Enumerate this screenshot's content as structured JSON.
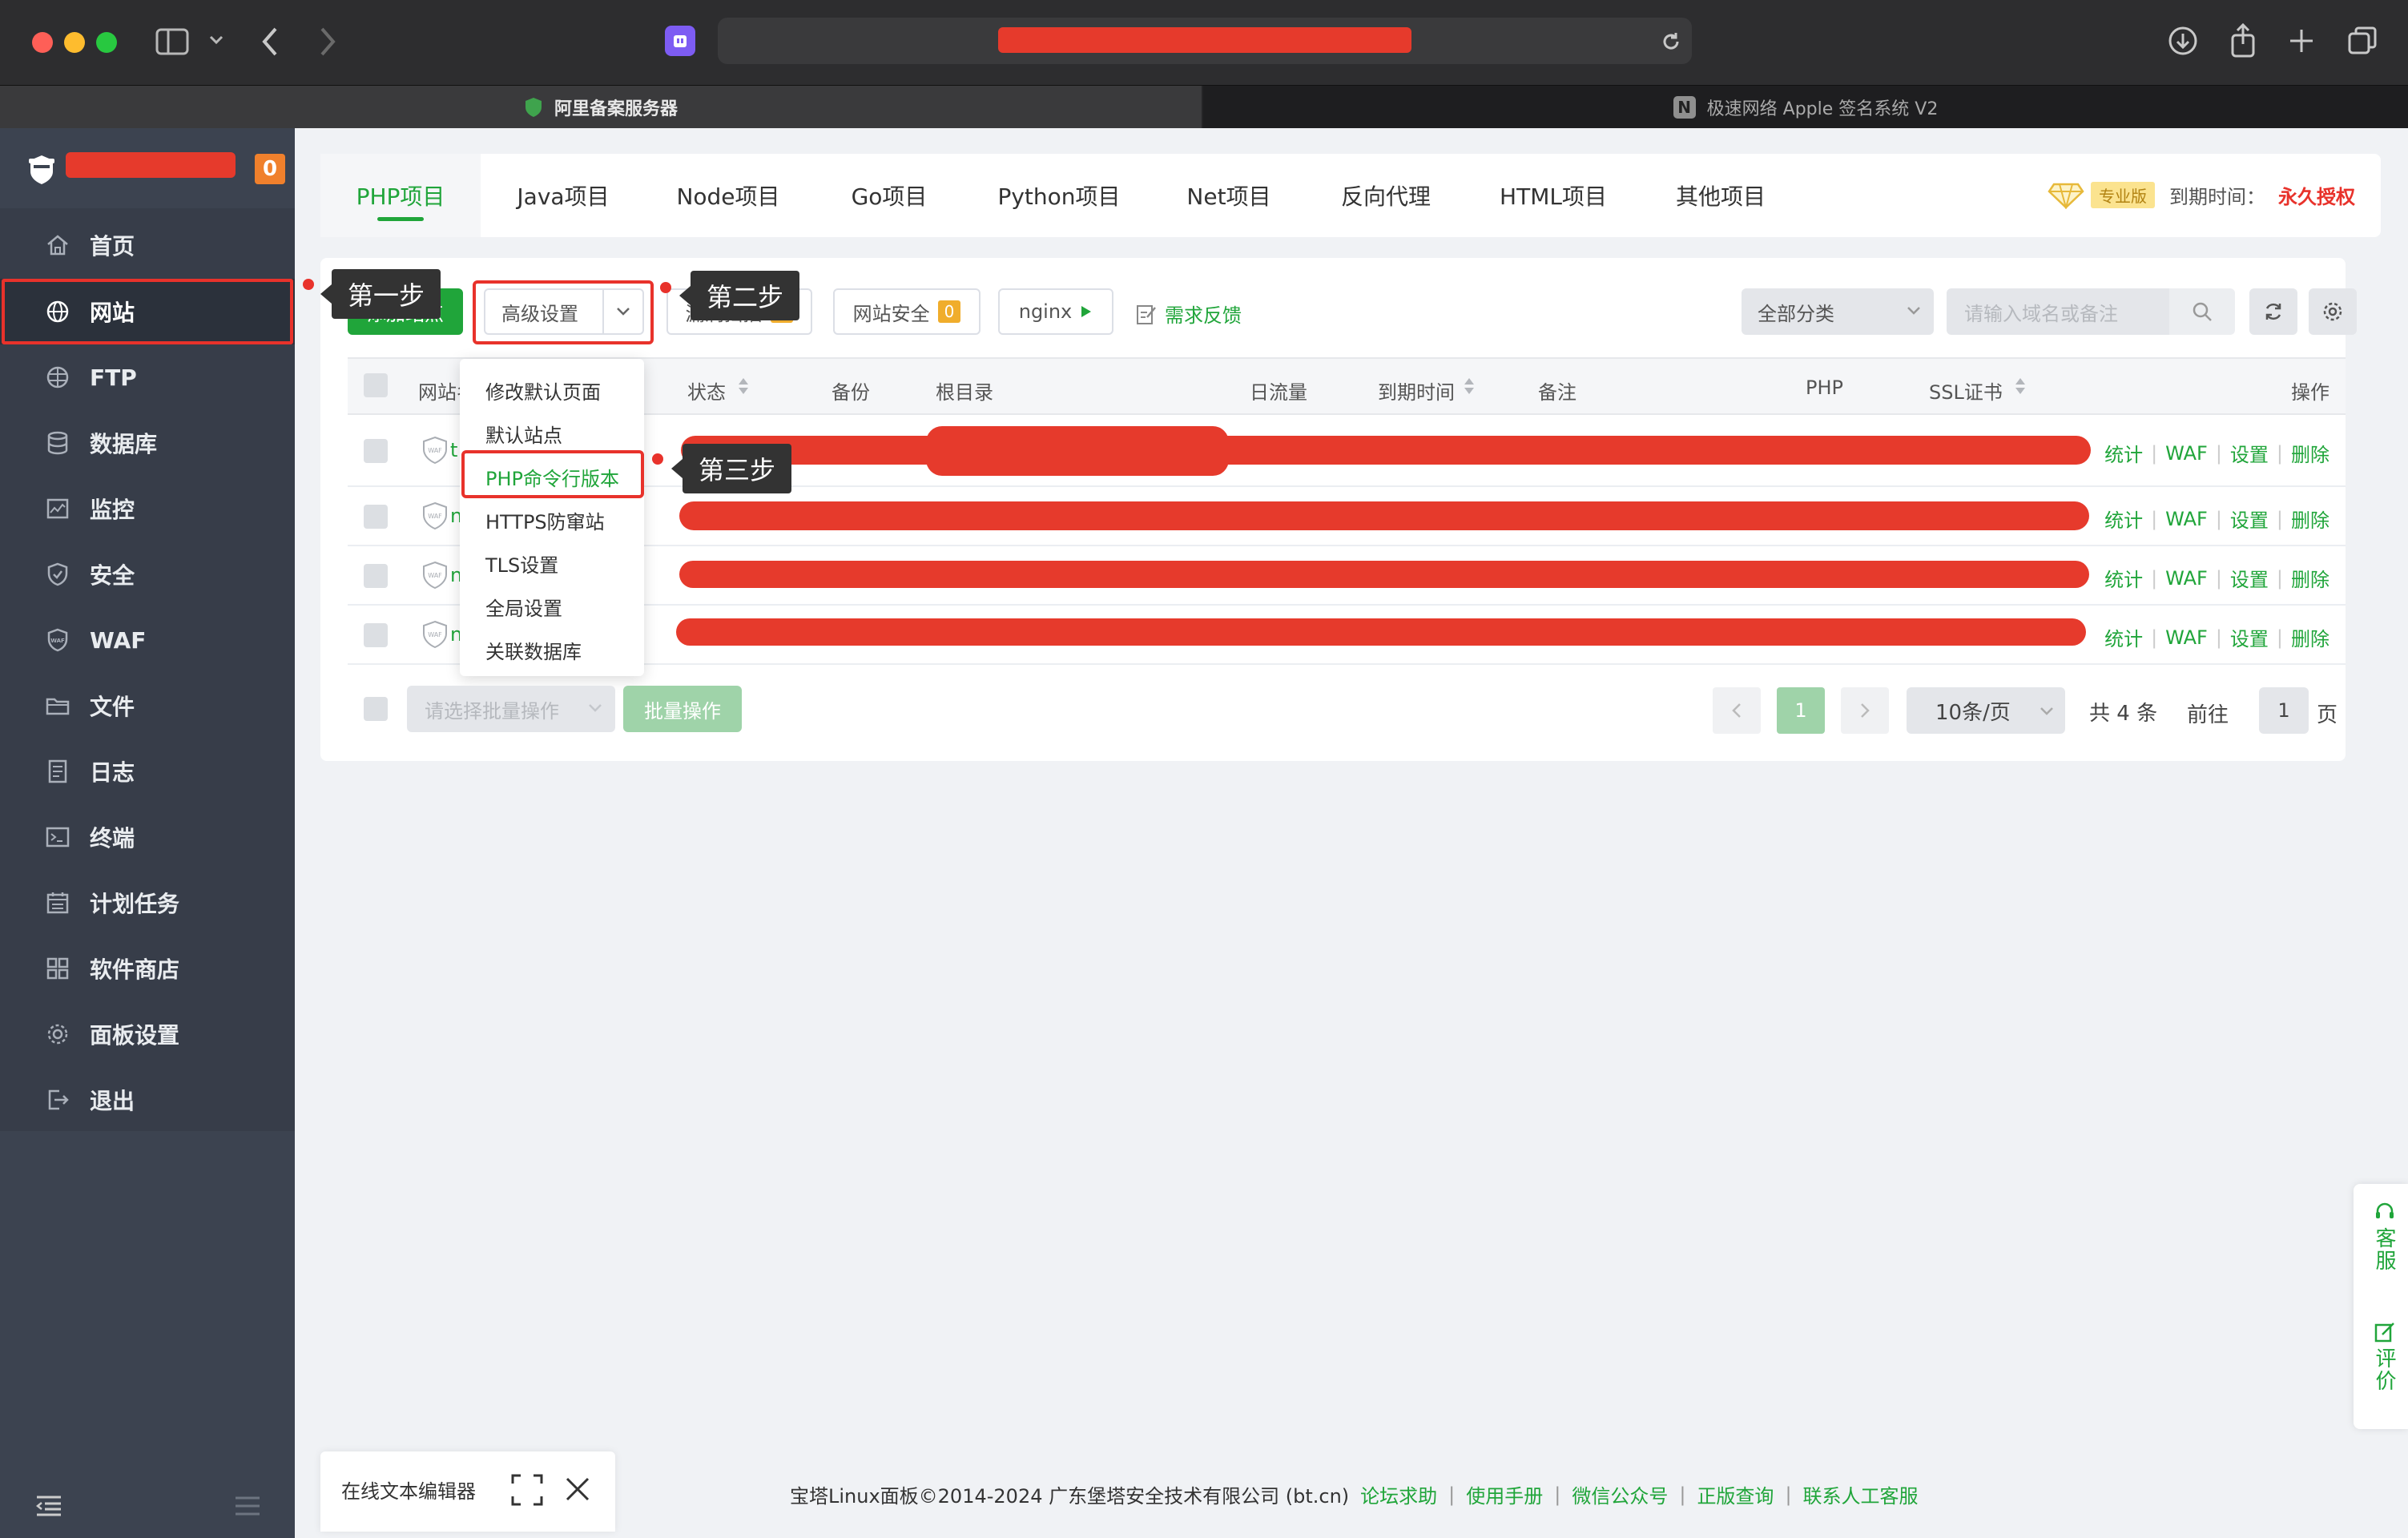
{
  "browser": {
    "tab_active": "阿里备案服务器",
    "tab_inactive": "极速网络 Apple 签名系统 V2",
    "tab_inactive_icon": "N"
  },
  "sidebar": {
    "badge_count": "0",
    "items": [
      {
        "label": "首页",
        "icon": "home-icon"
      },
      {
        "label": "网站",
        "icon": "globe-icon",
        "active": true
      },
      {
        "label": "FTP",
        "icon": "ftp-icon"
      },
      {
        "label": "数据库",
        "icon": "database-icon"
      },
      {
        "label": "监控",
        "icon": "monitor-icon"
      },
      {
        "label": "安全",
        "icon": "shield-icon"
      },
      {
        "label": "WAF",
        "icon": "waf-icon"
      },
      {
        "label": "文件",
        "icon": "folder-icon"
      },
      {
        "label": "日志",
        "icon": "log-icon"
      },
      {
        "label": "终端",
        "icon": "terminal-icon"
      },
      {
        "label": "计划任务",
        "icon": "calendar-icon"
      },
      {
        "label": "软件商店",
        "icon": "store-icon"
      },
      {
        "label": "面板设置",
        "icon": "gear-icon"
      },
      {
        "label": "退出",
        "icon": "logout-icon"
      }
    ]
  },
  "project_tabs": [
    "PHP项目",
    "Java项目",
    "Node项目",
    "Go项目",
    "Python项目",
    "Net项目",
    "反向代理",
    "HTML项目",
    "其他项目"
  ],
  "license": {
    "edition": "专业版",
    "expire_label": "到期时间：",
    "expire_value": "永久授权"
  },
  "toolbar": {
    "add_site": "添加站点",
    "advanced": "高级设置",
    "vuln_scan": "漏洞扫描",
    "vuln_count": "0",
    "site_security": "网站安全",
    "security_count": "0",
    "nginx": "nginx",
    "feedback": "需求反馈",
    "category": "全部分类",
    "search_placeholder": "请输入域名或备注"
  },
  "table": {
    "headers": [
      "网站名",
      "状态",
      "备份",
      "根目录",
      "日流量",
      "到期时间",
      "备注",
      "PHP",
      "SSL证书",
      "操作"
    ],
    "row_initials": [
      "t",
      "n",
      "n",
      "n"
    ],
    "ops": [
      "统计",
      "WAF",
      "设置",
      "删除"
    ]
  },
  "dropdown": [
    "修改默认页面",
    "默认站点",
    "PHP命令行版本",
    "HTTPS防窜站",
    "TLS设置",
    "全局设置",
    "关联数据库"
  ],
  "callouts": {
    "step1": "第一步",
    "step2": "第二步",
    "step3": "第三步"
  },
  "batch": {
    "select_placeholder": "请选择批量操作",
    "button": "批量操作"
  },
  "pagination": {
    "current": "1",
    "page_size": "10条/页",
    "total": "共 4 条",
    "goto_label": "前往",
    "goto_value": "1",
    "page_suffix": "页"
  },
  "footer": {
    "copyright": "宝塔Linux面板©2014-2024 广东堡塔安全技术有限公司 (bt.cn)",
    "links": [
      "论坛求助",
      "使用手册",
      "微信公众号",
      "正版查询",
      "联系人工客服"
    ]
  },
  "editor": {
    "title": "在线文本编辑器"
  },
  "float": {
    "service": "客服",
    "review": "评价"
  },
  "colors": {
    "accent": "#20a53a",
    "danger": "#e8322b",
    "sidebar": "#3c4350"
  }
}
